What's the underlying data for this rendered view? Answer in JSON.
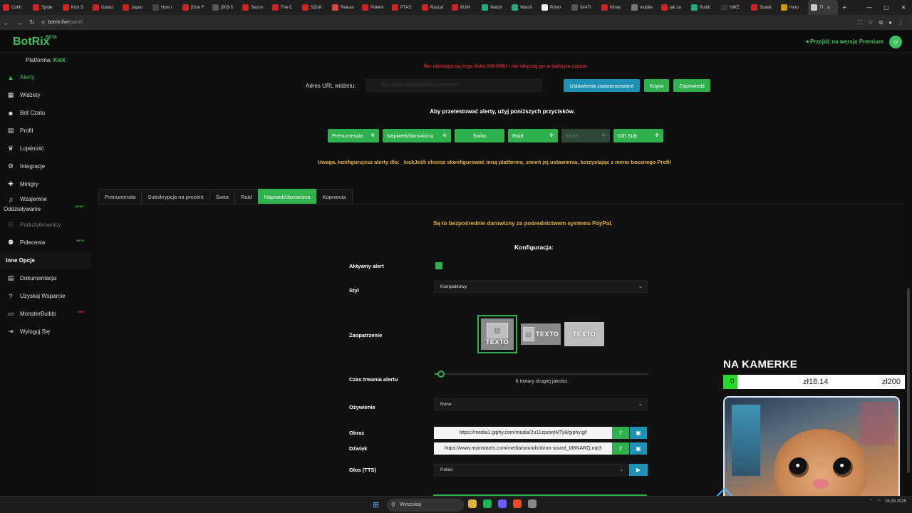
{
  "browser": {
    "tabs": [
      "Cohh",
      "Spide",
      "Kick S",
      "Galact",
      "Japan",
      "How t",
      "[One F",
      "[903-5",
      "Sezon",
      "The C",
      "SZUK",
      "Releas",
      "Pokém",
      "PTAS",
      "Rascal",
      "BUM",
      "Watch",
      "Watch",
      "Równ",
      "3I/ATI",
      "Minec",
      "mobile",
      "jak za",
      "Buildi",
      "NIKE",
      "Statek",
      "Hero",
      "Tł"
    ],
    "tab_colors": [
      "#d22",
      "#c22",
      "#c22",
      "#c22",
      "#c22",
      "#444",
      "#c22",
      "#555",
      "#c22",
      "#c22",
      "#c22",
      "#d44",
      "#c22",
      "#c22",
      "#c22",
      "#c22",
      "#2a7",
      "#2a7",
      "#eee",
      "#555",
      "#c22",
      "#777",
      "#c22",
      "#2a7",
      "#333",
      "#c22",
      "#c90",
      "#ccc"
    ],
    "url_host": "botrix.live",
    "url_path": "/panel"
  },
  "app": {
    "logo": "BotRix",
    "logo_badge": "BETA",
    "platform_label": "Platforma:",
    "platform_value": "Kick",
    "premium": "Przejdź na wersję Premium"
  },
  "sidebar": {
    "items": [
      {
        "label": "Alerty",
        "icon": "triangle-alert-icon",
        "glyph": "▲",
        "state": "active"
      },
      {
        "label": "Widżety",
        "icon": "grid-icon",
        "glyph": "▦"
      },
      {
        "label": "Bot Czatu",
        "icon": "robot-icon",
        "glyph": "☻"
      },
      {
        "label": "Profil",
        "icon": "profile-card-icon",
        "glyph": "▤"
      },
      {
        "label": "Lojalność",
        "icon": "trophy-icon",
        "glyph": "♛"
      },
      {
        "label": "Integracje",
        "icon": "gear-icon",
        "glyph": "⚙"
      },
      {
        "label": "Minigry",
        "icon": "gamepad-icon",
        "glyph": "✚"
      }
    ],
    "multi": {
      "line1": "Wzajemne",
      "line2": "Oddziaływanie",
      "tag": "NOWY",
      "icon": "music-icon",
      "glyph": "♫"
    },
    "items2": [
      {
        "label": "Podużytkownicy",
        "icon": "users-icon",
        "glyph": "⚇",
        "state": "dim"
      },
      {
        "label": "Polecenia",
        "icon": "people-icon",
        "glyph": "⚉",
        "tag": "BETA"
      }
    ],
    "section": "Inne Opcje",
    "items3": [
      {
        "label": "Dokumentacja",
        "icon": "docs-icon",
        "glyph": "▤"
      },
      {
        "label": "Uzyskaj Wsparcie",
        "icon": "question-icon",
        "glyph": "?"
      },
      {
        "label": "MonsterBuilds",
        "icon": "monitor-icon",
        "glyph": "▭",
        "tag": "NEW",
        "tagred": true
      },
      {
        "label": "Wyloguj Się",
        "icon": "logout-icon",
        "glyph": "⇥"
      }
    ]
  },
  "main": {
    "warning_top": "Nie udostępniaj tego linku NIKOMU i nie włączaj go w żadnym czasie.",
    "url_label": "Adres URL widżetu:",
    "url_value": "https://botrix.live/alerts?bid=••••••••••••••••",
    "btn_advanced": "Ustawienia zaawansowane",
    "btn_copy": "Kopia",
    "btn_invite": "Zapowiedź",
    "test_hint": "Aby przetestować alerty, użyj poniższych przycisków.",
    "test_buttons": [
      {
        "label": "Prenumerata",
        "plus": true,
        "w": 72
      },
      {
        "label": "Napiwek/darowizna",
        "plus": true,
        "w": 96
      },
      {
        "label": "Świta",
        "plus": false,
        "w": 70
      },
      {
        "label": "Raid",
        "plus": true,
        "w": 70
      },
      {
        "label": "Kicks",
        "plus": true,
        "w": 68,
        "disabled": true
      },
      {
        "label": "Gift Sub",
        "plus": true,
        "w": 70
      }
    ],
    "warning_mid": "Uwaga, konfigurujesz alerty dla: _kickJeśli chcesz skonfigurować inną platformę, zmień jej ustawienia, korzystając z menu bocznego Profil",
    "tabs": [
      {
        "label": "Prenumerata"
      },
      {
        "label": "Subskrypcja na prezent"
      },
      {
        "label": "Świta"
      },
      {
        "label": "Raid"
      },
      {
        "label": "Napiwek/darowizna",
        "active": true
      },
      {
        "label": "Kopniecia"
      }
    ],
    "paypal_note": "Są to bezpośrednie darowizny za pośrednictwem systemu PayPal.",
    "config_title": "Konfiguracja:",
    "labels": {
      "active": "Aktywny alert",
      "style": "Styl",
      "layout": "Zaopatrzenie",
      "duration": "Czas trwania alertu",
      "animation": "Ożywienie",
      "image": "Obraz",
      "sound": "Dźwięk",
      "tts": "Głos (TTS)"
    },
    "style_value": "Kompaktowy",
    "style_option_text": "TEXTO",
    "duration_text": "6 towary drugiej jakości",
    "duration_fraction": 0.03,
    "animation_value": "None",
    "image_url": "https://media1.giphy.com/media/2u11zpzwyMTy8/giphy.gif",
    "sound_url": "https://www.myinstants.com/media/sounds/dono-sound_I88NARQ.mp3",
    "tts_value": "Polski"
  },
  "overlay": {
    "title": "NA KAMERKE",
    "current": "0",
    "raised": "zł18.14",
    "goal": "zł200"
  },
  "taskbar": {
    "search": "Wyszukaj",
    "date": "15.09.2025",
    "app_colors": [
      "#e3b23c",
      "#1db954",
      "#6a5cff",
      "#e34c26",
      "#888"
    ]
  }
}
